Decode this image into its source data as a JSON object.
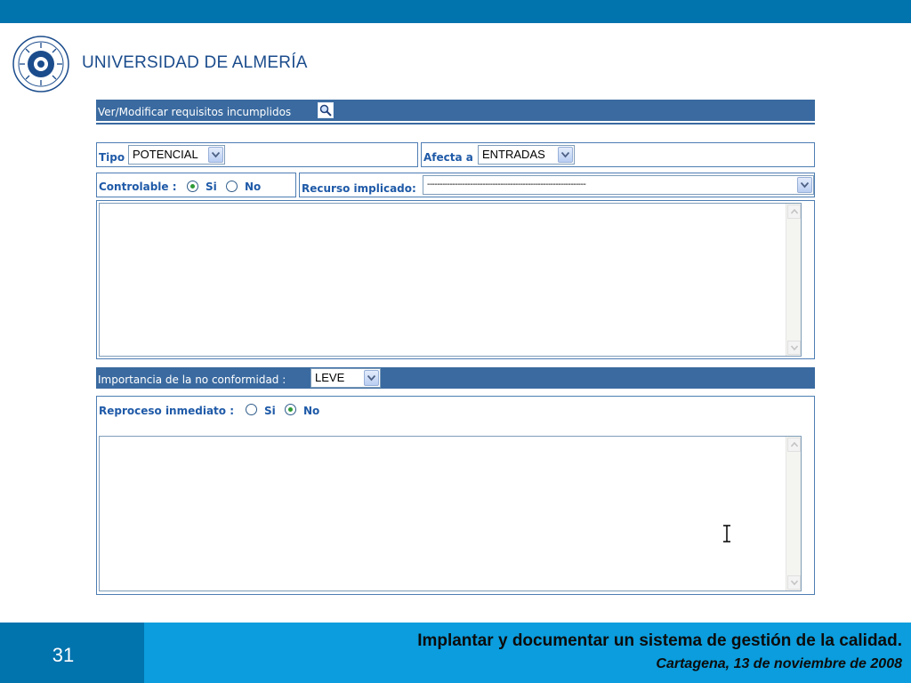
{
  "header": {
    "university_name": "UNIVERSIDAD DE ALMERÍA",
    "logo_icon": "university-seal-icon"
  },
  "form": {
    "title": "Ver/Modificar requisitos incumplidos",
    "search_icon": "search-icon",
    "tipo": {
      "label": "Tipo",
      "value": "POTENCIAL"
    },
    "afecta": {
      "label": "Afecta a",
      "value": "ENTRADAS"
    },
    "controlable": {
      "label": "Controlable :",
      "options": [
        "Si",
        "No"
      ],
      "selected": "Si"
    },
    "recurso": {
      "label": "Recurso implicado:",
      "value": "---------------------------------------------------------------"
    },
    "description": "",
    "importancia": {
      "label": "Importancia de la no conformidad :",
      "value": "LEVE"
    },
    "reproceso": {
      "label": "Reproceso inmediato :",
      "options": [
        "Si",
        "No"
      ],
      "selected": "No"
    },
    "reproceso_text": ""
  },
  "footer": {
    "slide_number": "31",
    "title": "Implantar y documentar un sistema de gestión de la calidad.",
    "subtitle": "Cartagena, 13 de noviembre de 2008"
  },
  "colors": {
    "top_band": "#0173ad",
    "footer_band": "#0b9ddd",
    "bar": "#3a6aa0",
    "label": "#1f5aa8"
  }
}
